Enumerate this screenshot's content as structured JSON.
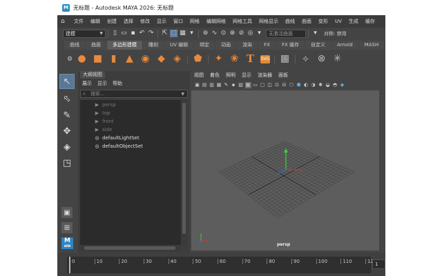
{
  "window": {
    "app_icon": "M",
    "title": "无标题 - Autodesk MAYA 2026: 无标题"
  },
  "menubar": {
    "home_icon": "home-icon",
    "items": [
      "文件",
      "编辑",
      "创建",
      "选择",
      "修改",
      "显示",
      "窗口",
      "网格",
      "编辑网格",
      "网格工具",
      "网格显示",
      "曲线",
      "曲面",
      "变形",
      "UV",
      "生成",
      "缓存"
    ]
  },
  "statusline": {
    "mode": "建模",
    "live_surface": "无激活曲面",
    "symmetry_label": "对称: 禁用"
  },
  "shelf": {
    "tabs": [
      "曲线",
      "曲面",
      "多边形建模",
      "雕刻",
      "UV 编辑",
      "绑定",
      "动画",
      "渲染",
      "FX",
      "FX 缓存",
      "自定义",
      "Arnold",
      "MASH"
    ],
    "active_tab": "多边形建模",
    "text_tool_glyph": "T",
    "svg_tool_label": "SVG",
    "accent_color": "#e8893b"
  },
  "outliner": {
    "title": "大纲视图",
    "menu": [
      "展示",
      "显示",
      "帮助"
    ],
    "search_placeholder": "搜索...",
    "items": [
      {
        "label": "persp",
        "type": "camera"
      },
      {
        "label": "top",
        "type": "camera"
      },
      {
        "label": "front",
        "type": "camera"
      },
      {
        "label": "side",
        "type": "camera"
      },
      {
        "label": "defaultLightSet",
        "type": "set"
      },
      {
        "label": "defaultObjectSet",
        "type": "set"
      }
    ]
  },
  "viewport": {
    "menu": [
      "视图",
      "着色",
      "照明",
      "显示",
      "渲染器",
      "面板"
    ],
    "camera_label": "persp"
  },
  "timeline": {
    "ticks": [
      0,
      10,
      20,
      30,
      40,
      50,
      60,
      70,
      80,
      90,
      100,
      110,
      120
    ],
    "current_frame": "1"
  }
}
